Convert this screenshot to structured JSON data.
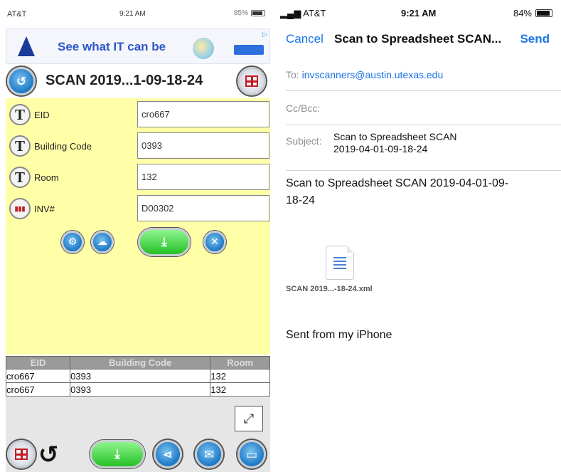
{
  "left_app": {
    "status": {
      "carrier": "AT&T",
      "time": "9:21 AM",
      "battery": "85%"
    },
    "ad": {
      "text": "See what IT can be"
    },
    "title": "SCAN 2019...1-09-18-24",
    "form": {
      "fields": [
        {
          "label": "EID",
          "value": "cro667",
          "icon": "text-field-icon"
        },
        {
          "label": "Building Code",
          "value": "0393",
          "icon": "text-field-icon"
        },
        {
          "label": "Room",
          "value": "132",
          "icon": "text-field-icon"
        },
        {
          "label": "INV#",
          "value": "D00302",
          "icon": "barcode-icon"
        }
      ]
    },
    "table": {
      "headers": [
        "EID",
        "Building Code",
        "Room"
      ],
      "rows": [
        [
          "cro667",
          "0393",
          "132"
        ],
        [
          "cro667",
          "0393",
          "132"
        ]
      ]
    },
    "colors": {
      "form_bg": "#ffffa8",
      "button_blue": "#1c77c6",
      "button_green": "#25c025"
    }
  },
  "right_app": {
    "status": {
      "carrier": "AT&T",
      "time": "9:21 AM",
      "battery": "84%"
    },
    "nav": {
      "cancel": "Cancel",
      "title": "Scan to Spreadsheet SCAN...",
      "send": "Send"
    },
    "to_label": "To:",
    "to_value": "invscanners@austin.utexas.edu",
    "ccbcc_label": "Cc/Bcc:",
    "subject_label": "Subject:",
    "subject_line1": "Scan to Spreadsheet SCAN",
    "subject_line2": "2019-04-01-09-18-24",
    "body_line1": "Scan to Spreadsheet SCAN 2019-04-01-09-",
    "body_line2": "18-24",
    "attachment_name": "SCAN 2019...-18-24.xml",
    "signature": "Sent from my iPhone",
    "colors": {
      "link": "#1a74e8"
    }
  }
}
